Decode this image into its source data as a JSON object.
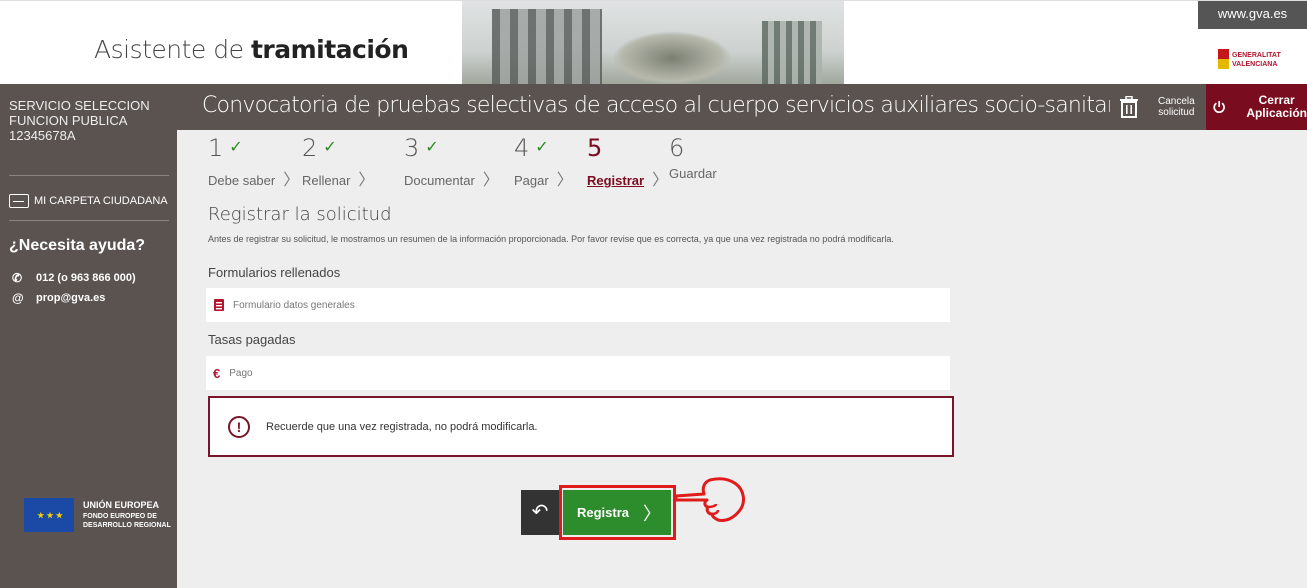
{
  "header": {
    "title_light": "Asistente de ",
    "title_bold": "tramitación",
    "gva_link": "www.gva.es",
    "generalitat": [
      "GENERALITAT",
      "VALENCIANA"
    ]
  },
  "sidebar": {
    "user": [
      "SERVICIO SELECCION",
      "FUNCION PUBLICA",
      "12345678A"
    ],
    "carpeta": "MI CARPETA CIUDADANA",
    "help_title": "¿Necesita ayuda?",
    "phone": "012 (o 963 866 000)",
    "email": "prop@gva.es",
    "eu": [
      "UNIÓN EUROPEA",
      "FONDO EUROPEO DE",
      "DESARROLLO REGIONAL"
    ]
  },
  "topbar": {
    "convocatoria": "Convocatoria de pruebas selectivas de acceso al cuerpo servicios auxiliares socio-sanitarios y educativos de la Adm",
    "cancel": [
      "Cancela",
      "solicitud"
    ],
    "close": [
      "Cerrar",
      "Aplicación"
    ]
  },
  "steps": [
    {
      "num": "1",
      "label": "Debe saber"
    },
    {
      "num": "2",
      "label": "Rellenar"
    },
    {
      "num": "3",
      "label": "Documentar"
    },
    {
      "num": "4",
      "label": "Pagar"
    },
    {
      "num": "5",
      "label": "Registrar"
    },
    {
      "num": "6",
      "label": "Guardar"
    }
  ],
  "main": {
    "title": "Registrar la solicitud",
    "desc": "Antes de registrar su solicitud, le mostramos un resumen de la información proporcionada. Por favor revise que es correcta, ya que una vez registrada no podrá modificarla.",
    "forms_title": "Formularios rellenados",
    "form_item": "Formulario datos generales",
    "fees_title": "Tasas pagadas",
    "fee_item": "Pago",
    "warning": "Recuerde que una vez registrada, no podrá modificarla.",
    "register_button": "Registra"
  },
  "colors": {
    "brand": "#7a0c1f",
    "sidebar": "#5a5350",
    "success": "#2d8d2d",
    "highlight": "#e01b1b"
  }
}
